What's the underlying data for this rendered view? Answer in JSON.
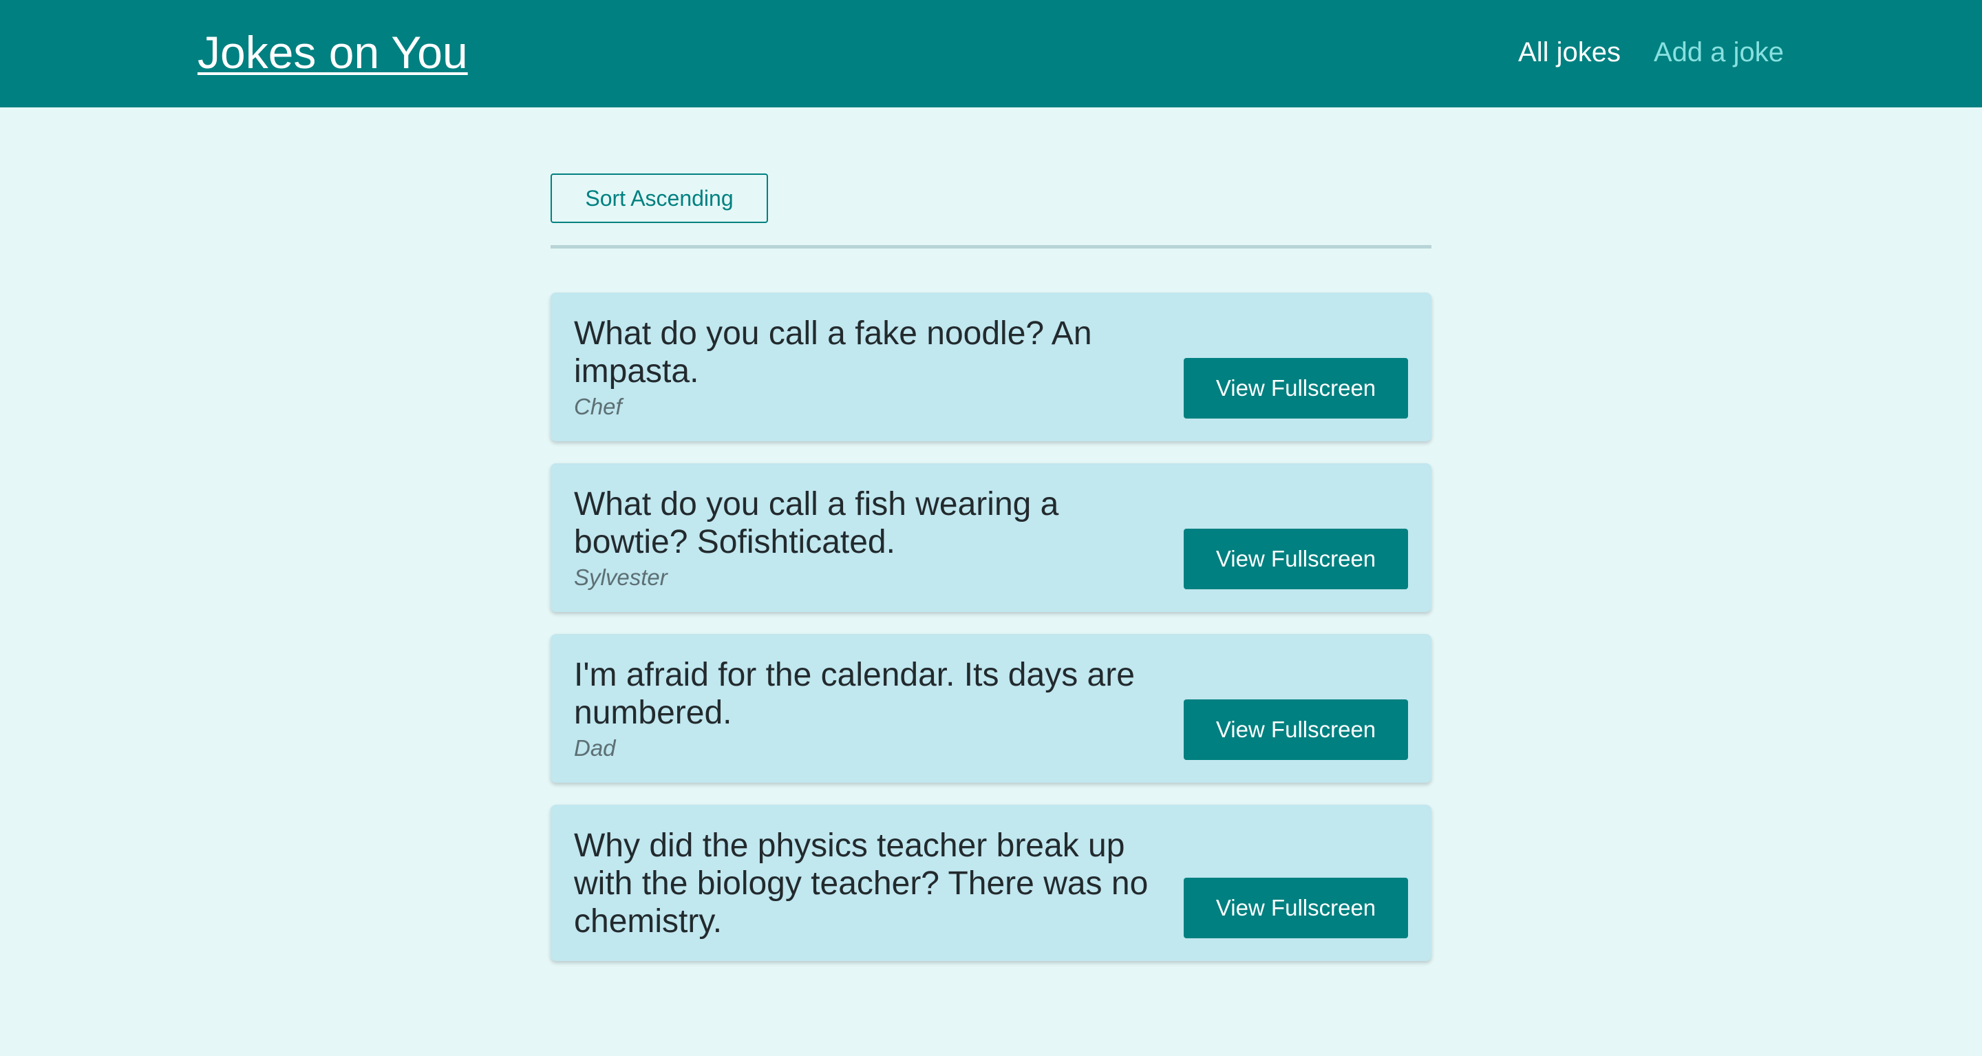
{
  "header": {
    "logo": "Jokes on You",
    "nav": {
      "all_jokes": "All jokes",
      "add_joke": "Add a joke"
    }
  },
  "toolbar": {
    "sort_label": "Sort Ascending"
  },
  "jokes": [
    {
      "text": "What do you call a fake noodle? An impasta.",
      "author": "Chef",
      "button": "View Fullscreen"
    },
    {
      "text": "What do you call a fish wearing a bowtie? Sofishticated.",
      "author": "Sylvester",
      "button": "View Fullscreen"
    },
    {
      "text": "I'm afraid for the calendar. Its days are numbered.",
      "author": "Dad",
      "button": "View Fullscreen"
    },
    {
      "text": "Why did the physics teacher break up with the biology teacher? There was no chemistry.",
      "author": "",
      "button": "View Fullscreen"
    }
  ],
  "colors": {
    "header_bg": "#008080",
    "page_bg": "#e5f7f7",
    "card_bg": "#c1e7ef",
    "accent": "#008080",
    "nav_inactive": "#88e0e0"
  }
}
